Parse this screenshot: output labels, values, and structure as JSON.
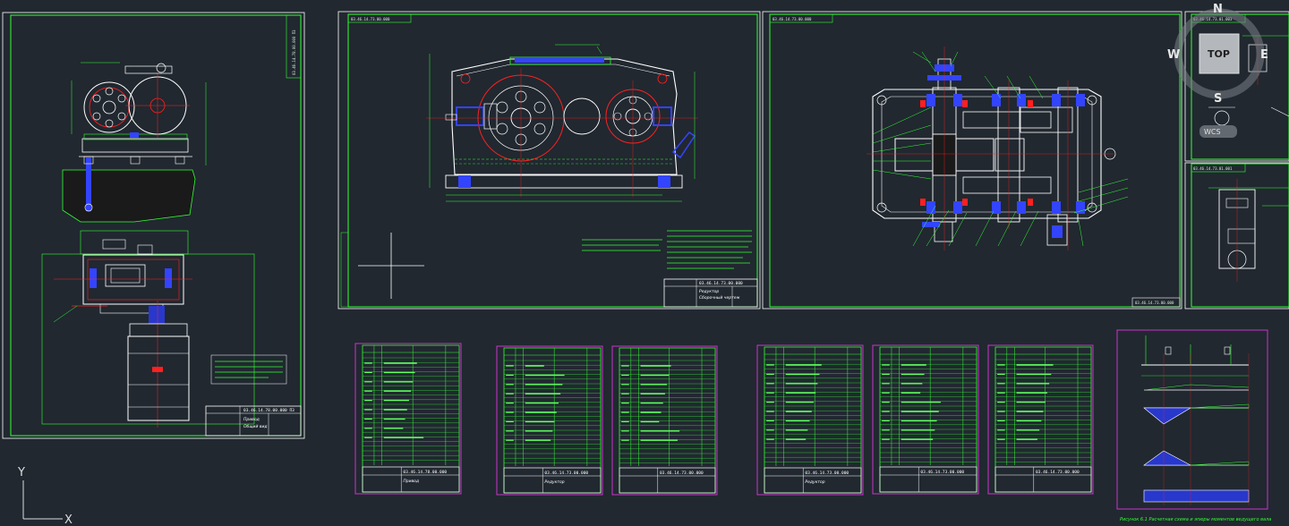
{
  "sheets": {
    "assembly": {
      "code": "03.46.14.78.00.000 ПЗ",
      "name": "Привод",
      "stamp": "Общий вид"
    },
    "gearbox_front": {
      "code": "03.46.14.73.00.000",
      "name": "Редуктор",
      "stamp": "Сборочный чертеж",
      "tl_code": "03.46.14.73.00.000"
    },
    "gearbox_top": {
      "code": "03.46.14.73.00.000",
      "tl_code": "03.46.14.73.00.000"
    },
    "detail_1": {
      "tl_code": "03.46.14.73.01.003"
    },
    "detail_2": {
      "tl_code": "03.46.14.73.01.001"
    },
    "specs": [
      {
        "code": "03.46.14.78.00.000",
        "name": "Привод"
      },
      {
        "code": "03.46.14.73.00.000",
        "name": "Редуктор"
      },
      {
        "code": "03.46.14.73.00.000",
        "name": ""
      },
      {
        "code": "03.46.14.73.00.000",
        "name": "Редуктор"
      },
      {
        "code": "03.46.14.73.00.000",
        "name": ""
      },
      {
        "code": "03.46.14.73.00.000",
        "name": ""
      }
    ],
    "diagram_caption": "Рисунок 6.1 Расчетная схема и эпюры моментов ведущего вала"
  },
  "viewcube": {
    "north": "N",
    "south": "S",
    "east": "E",
    "west": "W",
    "top": "TOP",
    "wcs": "WCS"
  },
  "ucs": {
    "x": "X",
    "y": "Y"
  },
  "colors": {
    "background": "#212830",
    "frame": "#33ff33",
    "spec_frame": "#cc33cc",
    "red": "#ff2020",
    "blue": "#3344ff",
    "white": "#ffffff"
  }
}
